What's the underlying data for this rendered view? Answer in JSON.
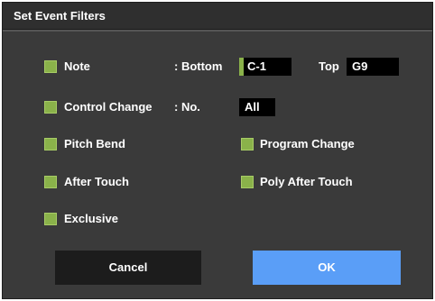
{
  "dialog": {
    "title": "Set Event Filters"
  },
  "filters": {
    "note": {
      "label": "Note",
      "checked": true
    },
    "control_change": {
      "label": "Control Change",
      "checked": true
    },
    "pitch_bend": {
      "label": "Pitch Bend",
      "checked": true
    },
    "program_change": {
      "label": "Program Change",
      "checked": true
    },
    "after_touch": {
      "label": "After Touch",
      "checked": true
    },
    "poly_after_touch": {
      "label": "Poly After Touch",
      "checked": true
    },
    "exclusive": {
      "label": "Exclusive",
      "checked": true
    }
  },
  "note_range": {
    "bottom_label": ": Bottom",
    "bottom_value": "C-1",
    "top_label": "Top",
    "top_value": "G9"
  },
  "control_change_no": {
    "label": ": No.",
    "value": "All"
  },
  "buttons": {
    "cancel": "Cancel",
    "ok": "OK"
  },
  "colors": {
    "checkbox": "#8ab24a",
    "ok_button": "#5a9ef7",
    "cancel_button": "#1c1c1c",
    "dialog_bg": "#3a3a3a"
  }
}
